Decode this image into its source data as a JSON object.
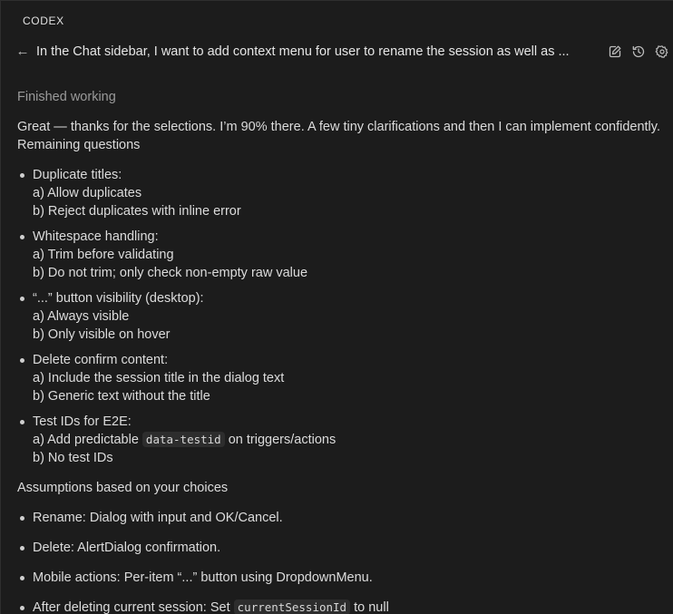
{
  "panel": {
    "title": "CODEX"
  },
  "header": {
    "back_icon": "arrow-left-icon",
    "thread_title": "In the Chat sidebar, I want to add context menu for user to rename the session as well as ...",
    "icons": [
      "edit-icon",
      "history-icon",
      "settings-icon"
    ]
  },
  "message": {
    "status": "Finished working",
    "intro_line1": "Great — thanks for the selections. I’m 90% there. A few tiny clarifications and then I can implement confidently.",
    "remaining_heading": "Remaining questions",
    "questions": [
      {
        "title": "Duplicate titles:",
        "a": "a) Allow duplicates",
        "b": "b) Reject duplicates with inline error"
      },
      {
        "title": "Whitespace handling:",
        "a": "a) Trim before validating",
        "b": "b) Do not trim; only check non-empty raw value"
      },
      {
        "title": "“...” button visibility (desktop):",
        "a": "a) Always visible",
        "b": "b) Only visible on hover"
      },
      {
        "title": "Delete confirm content:",
        "a": "a) Include the session title in the dialog text",
        "b": "b) Generic text without the title"
      },
      {
        "title": "Test IDs for E2E:",
        "a_prefix": "a) Add predictable ",
        "a_code": "data-testid",
        "a_suffix": " on triggers/actions",
        "b": "b) No test IDs"
      }
    ],
    "assumptions_heading": "Assumptions based on your choices",
    "assumptions": [
      "Rename: Dialog with input and OK/Cancel.",
      "Delete: AlertDialog confirmation.",
      "Mobile actions: Per-item “...” button using DropdownMenu."
    ],
    "last_item_prefix": "After deleting current session: Set ",
    "last_item_code": "currentSessionId",
    "last_item_suffix": " to null"
  }
}
